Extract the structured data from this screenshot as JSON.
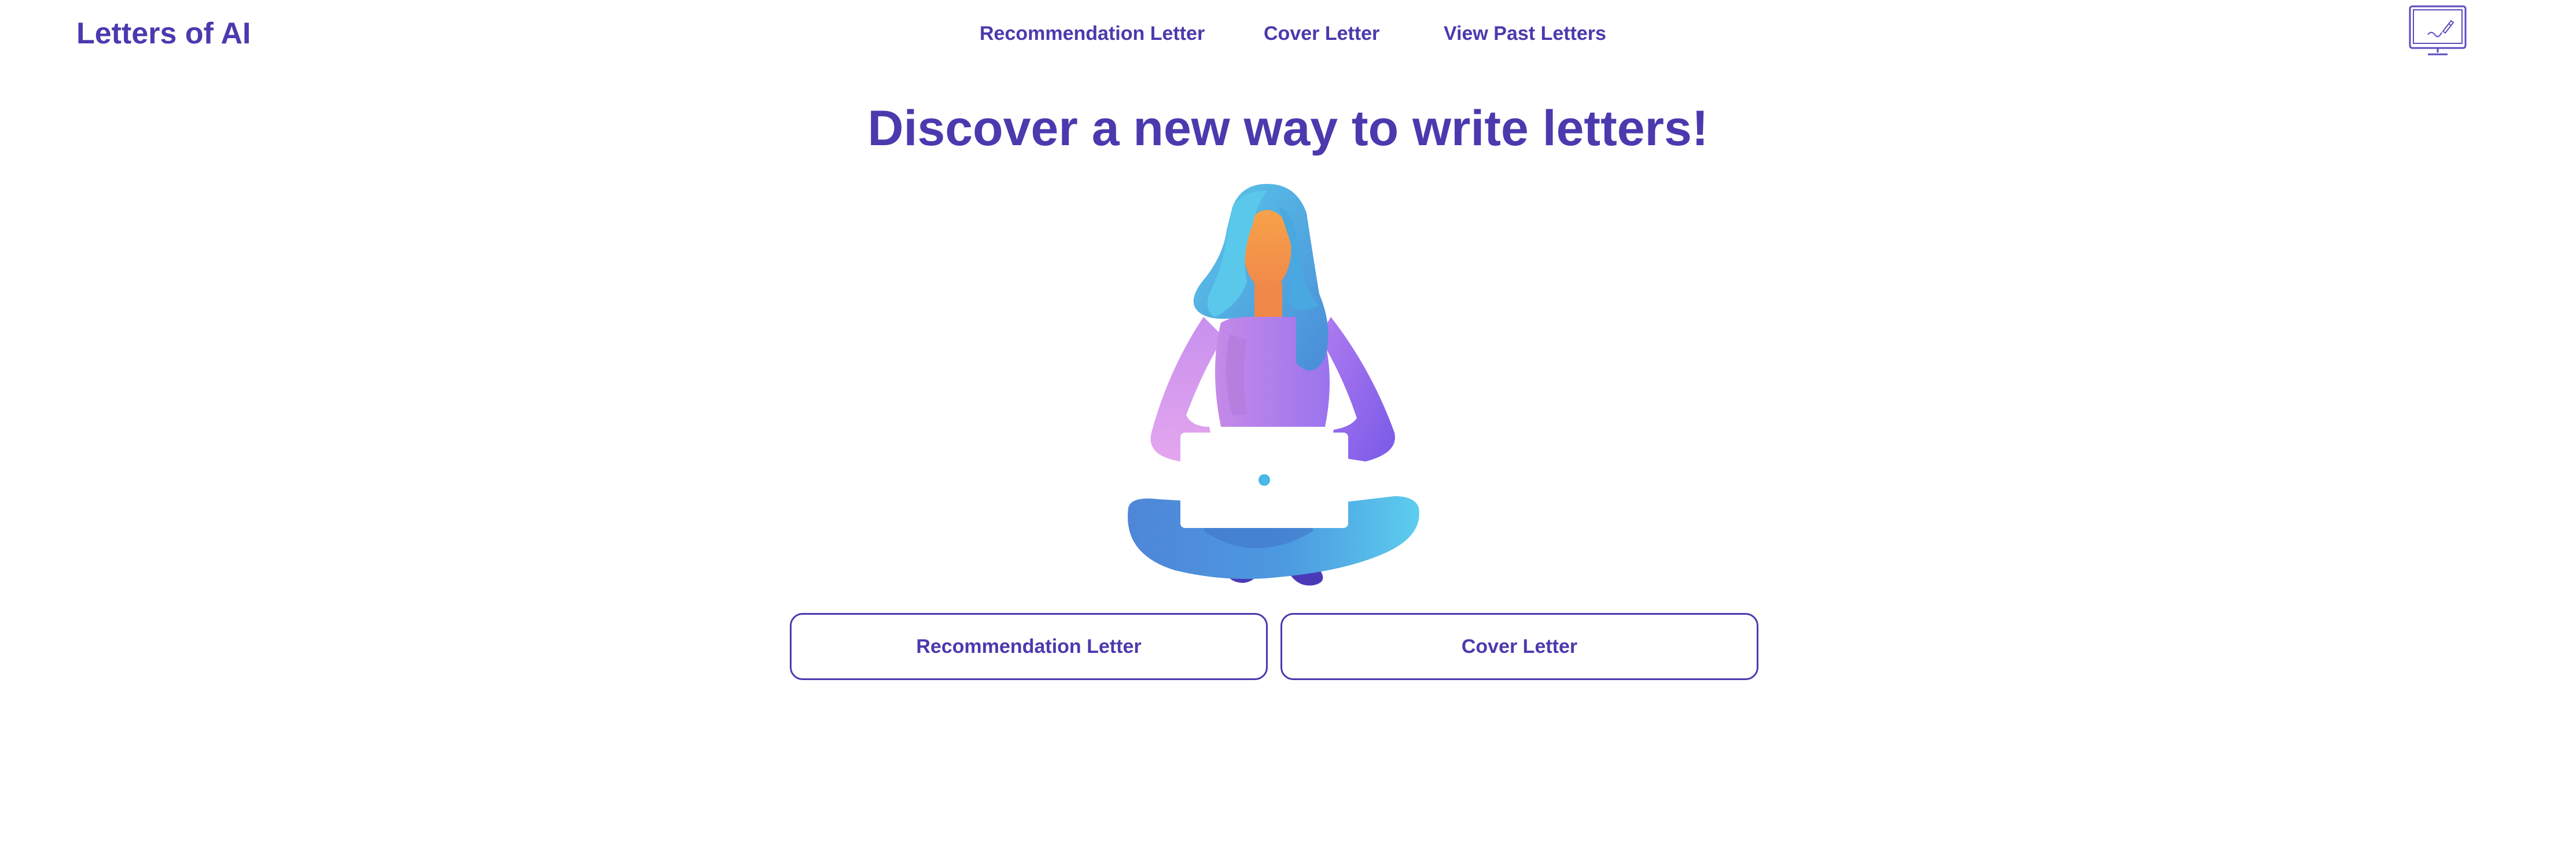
{
  "header": {
    "brand": "Letters of AI",
    "nav": {
      "recommendation": "Recommendation Letter",
      "cover": "Cover Letter",
      "past": "View Past Letters"
    },
    "icon": "monitor-pen-icon"
  },
  "hero": {
    "title": "Discover a new way to write letters!",
    "illustration": "woman-with-laptop-illustration"
  },
  "actions": {
    "recommendation_label": "Recommendation Letter",
    "cover_label": "Cover Letter"
  },
  "colors": {
    "accent": "#4a3aae",
    "hair": "#5ac3e6",
    "skin": "#f7a24a",
    "shirt": "#a77cf0",
    "legs": "#5b8edc",
    "feet": "#4a3ab8"
  }
}
